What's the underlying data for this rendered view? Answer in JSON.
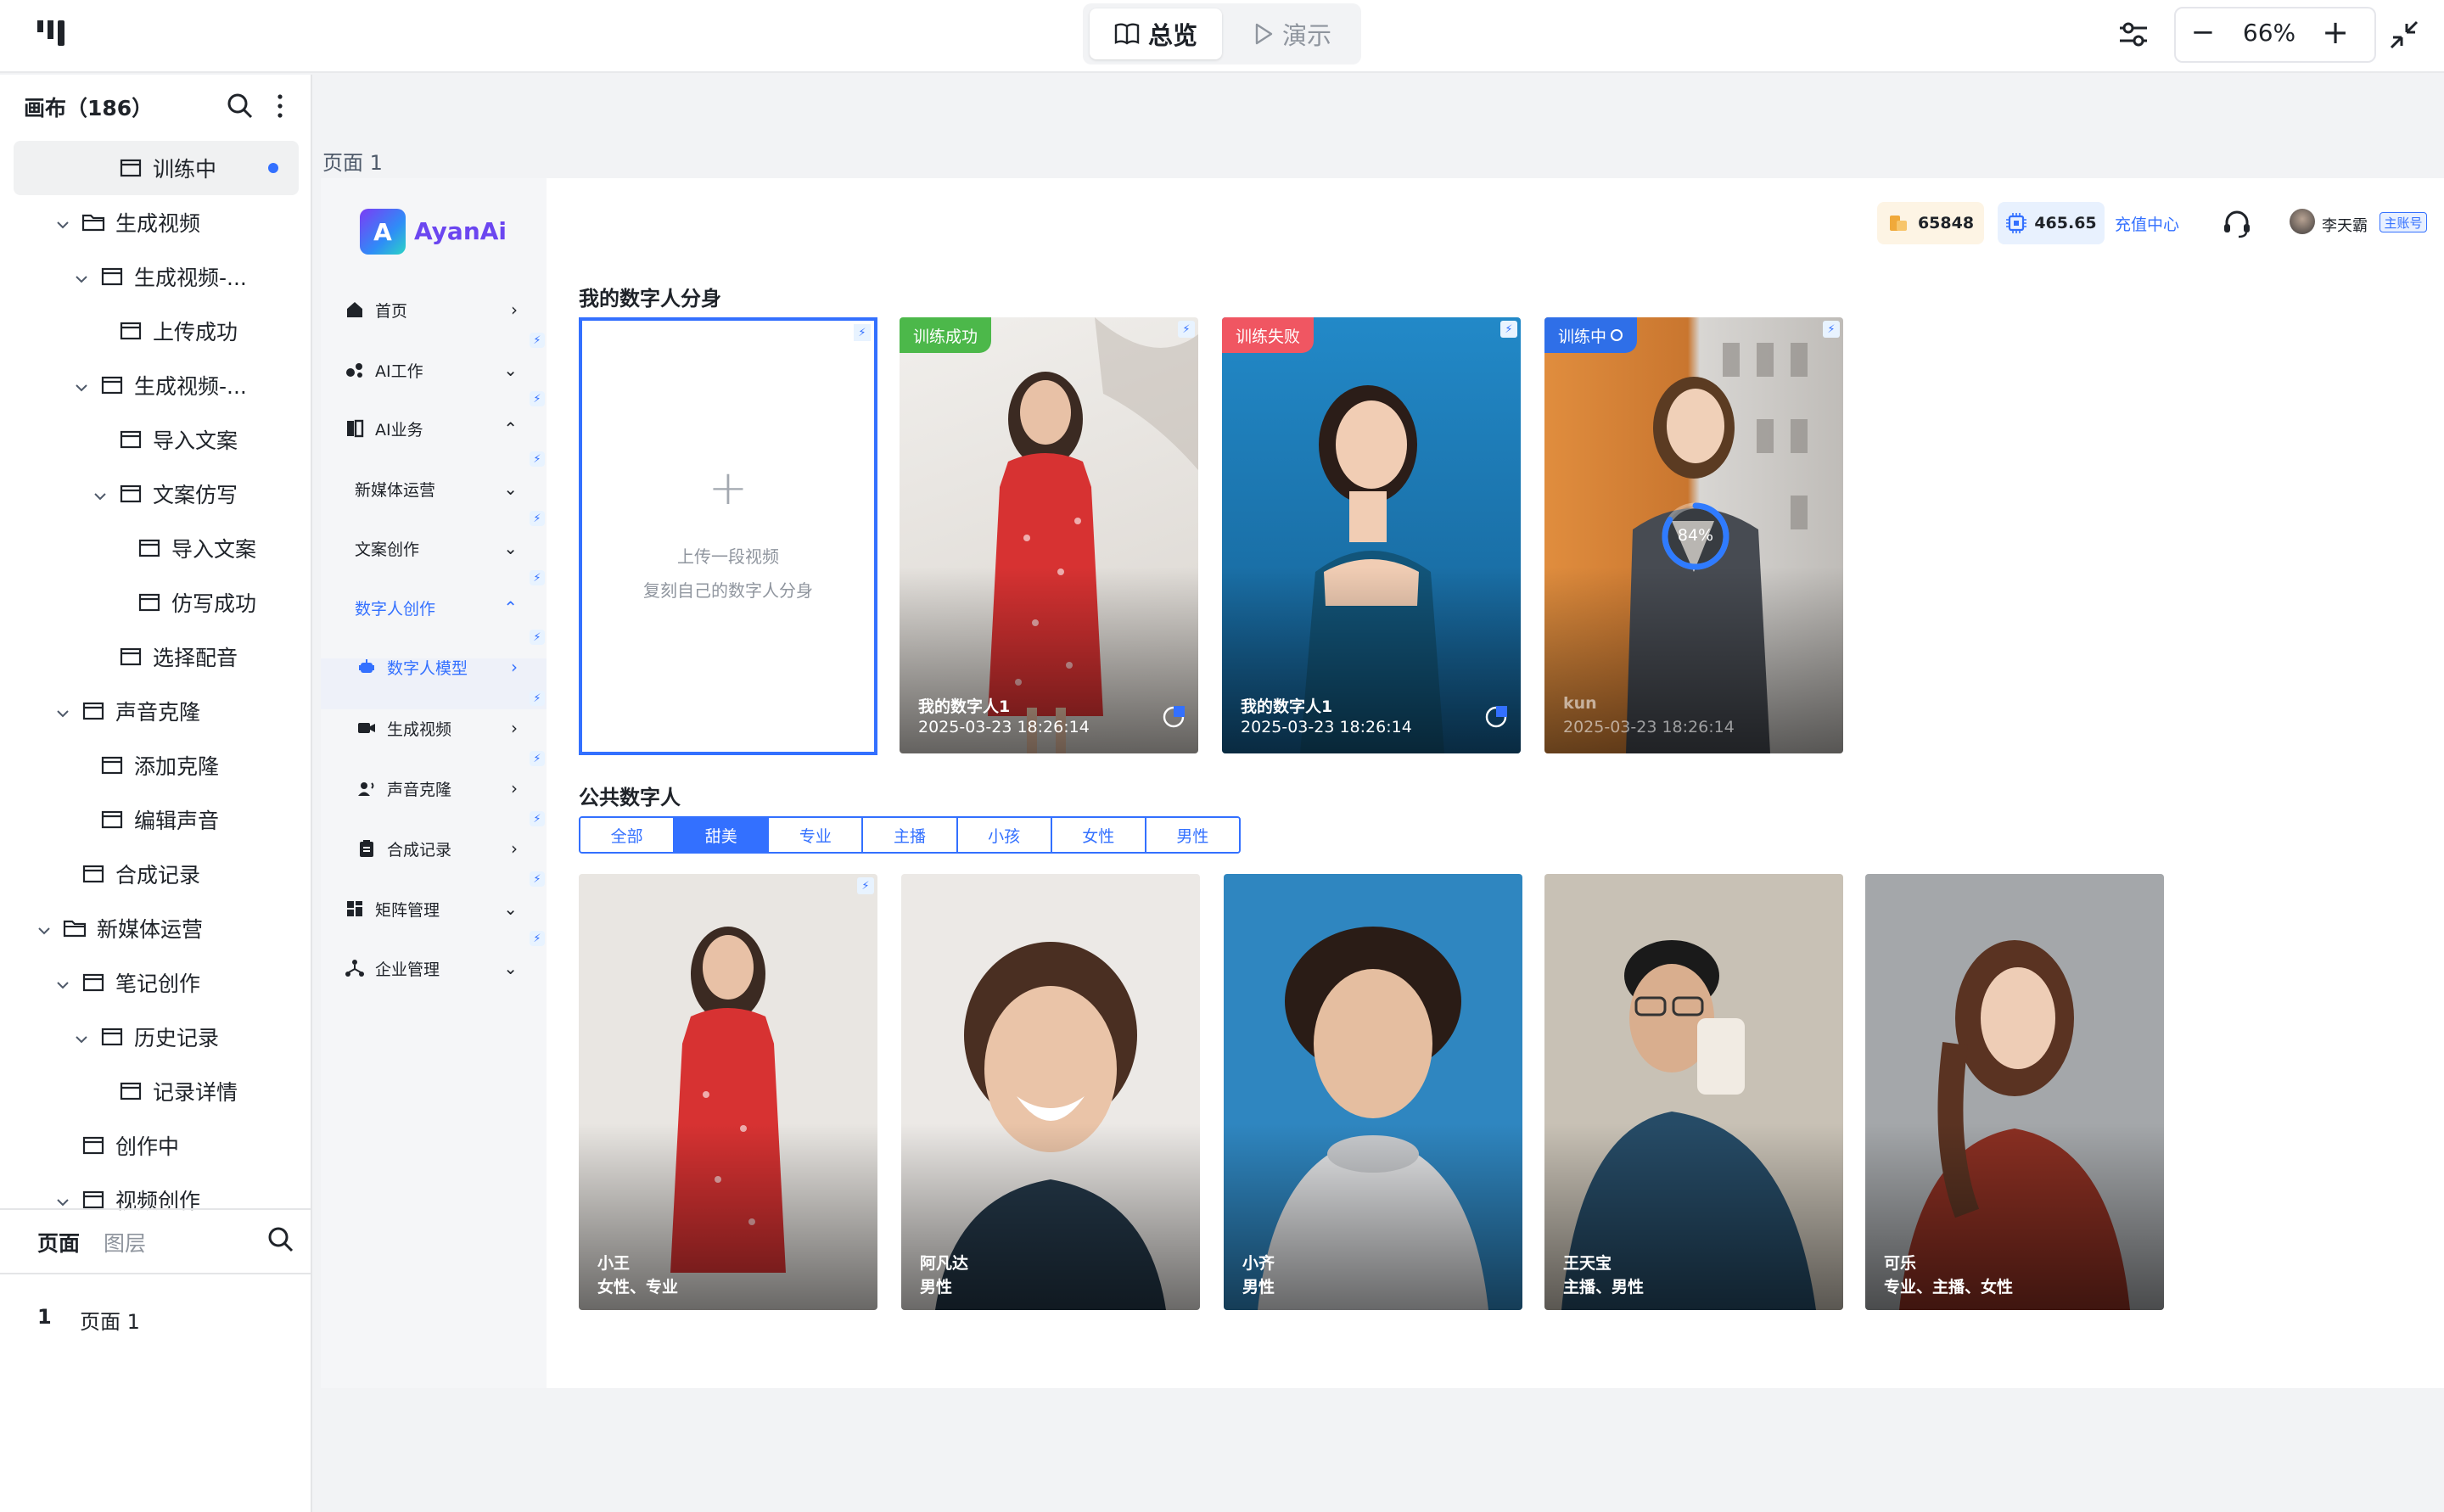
{
  "toolbar": {
    "mode_overview": "总览",
    "mode_present": "演示",
    "zoom": "66%",
    "zoom_minus": "−",
    "zoom_plus": "+"
  },
  "left_panel": {
    "title": "画布（186）",
    "tree": [
      {
        "label": "训练中",
        "level": 3,
        "type": "frame",
        "selected": true
      },
      {
        "label": "生成视频",
        "level": 1,
        "type": "folder",
        "expanded": true
      },
      {
        "label": "生成视频-...",
        "level": 2,
        "type": "frame",
        "expanded": true
      },
      {
        "label": "上传成功",
        "level": 3,
        "type": "frame"
      },
      {
        "label": "生成视频-...",
        "level": 2,
        "type": "frame",
        "expanded": true
      },
      {
        "label": "导入文案",
        "level": 3,
        "type": "frame"
      },
      {
        "label": "文案仿写",
        "level": 3,
        "type": "frame",
        "expanded": true
      },
      {
        "label": "导入文案",
        "level": 4,
        "type": "frame"
      },
      {
        "label": "仿写成功",
        "level": 4,
        "type": "frame"
      },
      {
        "label": "选择配音",
        "level": 3,
        "type": "frame"
      },
      {
        "label": "声音克隆",
        "level": 1,
        "type": "frame",
        "expanded": true
      },
      {
        "label": "添加克隆",
        "level": 2,
        "type": "frame"
      },
      {
        "label": "编辑声音",
        "level": 2,
        "type": "frame"
      },
      {
        "label": "合成记录",
        "level": 1,
        "type": "frame"
      },
      {
        "label": "新媒体运营",
        "level": 0,
        "type": "folder",
        "expanded": true
      },
      {
        "label": "笔记创作",
        "level": 1,
        "type": "frame",
        "expanded": true
      },
      {
        "label": "历史记录",
        "level": 2,
        "type": "frame",
        "expanded": true
      },
      {
        "label": "记录详情",
        "level": 3,
        "type": "frame"
      },
      {
        "label": "创作中",
        "level": 1,
        "type": "frame"
      },
      {
        "label": "视频创作",
        "level": 1,
        "type": "frame",
        "expanded": true
      }
    ],
    "tab_pages": "页面",
    "tab_layers": "图层",
    "pages": [
      {
        "num": "1",
        "name": "页面 1"
      }
    ]
  },
  "canvas": {
    "frame_label": "页面 1"
  },
  "app": {
    "brand_letter": "A",
    "brand_name": "AyanAi",
    "nav": [
      {
        "label": "首页",
        "icon": "home-icon",
        "arrow": "›",
        "indent": 0
      },
      {
        "label": "AI工作",
        "icon": "nodes-icon",
        "arrow": "⌄",
        "indent": 0
      },
      {
        "label": "AI业务",
        "icon": "book-icon",
        "arrow": "⌃",
        "indent": 0
      },
      {
        "label": "新媒体运营",
        "icon": "",
        "arrow": "⌄",
        "indent": 1
      },
      {
        "label": "文案创作",
        "icon": "",
        "arrow": "⌄",
        "indent": 1
      },
      {
        "label": "数字人创作",
        "icon": "",
        "arrow": "⌃",
        "indent": 1,
        "accent": true
      },
      {
        "label": "数字人模型",
        "icon": "robot-icon",
        "arrow": "›",
        "indent": 2,
        "active": true
      },
      {
        "label": "生成视频",
        "icon": "camera-icon",
        "arrow": "›",
        "indent": 2
      },
      {
        "label": "声音克隆",
        "icon": "voice-icon",
        "arrow": "›",
        "indent": 2
      },
      {
        "label": "合成记录",
        "icon": "clipboard-icon",
        "arrow": "›",
        "indent": 2
      },
      {
        "label": "矩阵管理",
        "icon": "grid-icon",
        "arrow": "⌄",
        "indent": 0
      },
      {
        "label": "企业管理",
        "icon": "org-icon",
        "arrow": "⌄",
        "indent": 0
      }
    ],
    "header": {
      "coins": "65848",
      "compute": "465.65",
      "recharge": "充值中心",
      "user_name": "李天霸",
      "account_tag": "主账号"
    },
    "my_section_title": "我的数字人分身",
    "upload": {
      "plus": "+",
      "line1": "上传一段视频",
      "line2": "复刻自己的数字人分身"
    },
    "my_cards": [
      {
        "status": "训练成功",
        "status_color": "#4cb84a",
        "name": "我的数字人1",
        "date": "2025-03-23 18:26:14",
        "bg": "#e9e6e2"
      },
      {
        "status": "训练失败",
        "status_color": "#f05662",
        "name": "我的数字人1",
        "date": "2025-03-23 18:26:14",
        "bg": "#1f86c2"
      },
      {
        "status": "训练中",
        "status_color": "#2f6fe8",
        "name": "kun",
        "date": "2025-03-23 18:26:14",
        "bg": "#d88a3c",
        "progress": 84,
        "progress_label": "84%"
      }
    ],
    "public_section_title": "公共数字人",
    "filters": [
      "全部",
      "甜美",
      "专业",
      "主播",
      "小孩",
      "女性",
      "男性"
    ],
    "active_filter": "甜美",
    "public_cards": [
      {
        "name": "小王",
        "tags": "女性、专业",
        "bg": "#e9e6e2"
      },
      {
        "name": "阿凡达",
        "tags": "男性",
        "bg": "#ece9e6"
      },
      {
        "name": "小齐",
        "tags": "男性",
        "bg": "#2f86c0"
      },
      {
        "name": "王天宝",
        "tags": "主播、男性",
        "bg": "#c8c1b5"
      },
      {
        "name": "可乐",
        "tags": "专业、主播、女性",
        "bg": "#a4a7aa"
      }
    ],
    "bolt": "⚡"
  }
}
